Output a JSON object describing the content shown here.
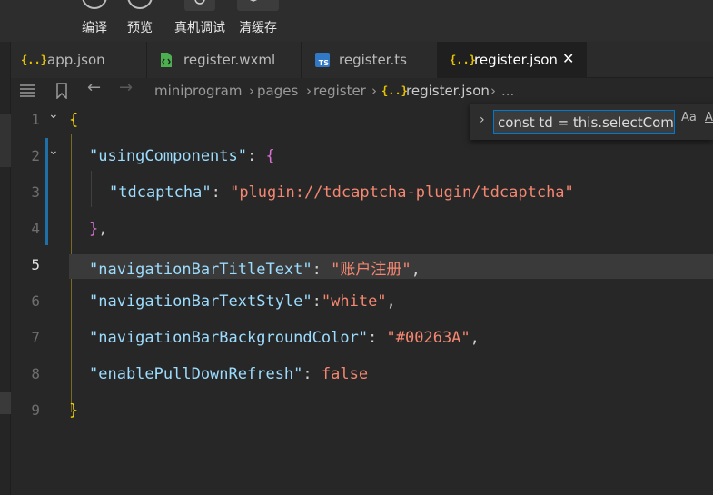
{
  "toolbar": {
    "compile_label": "编译",
    "preview_label": "预览",
    "debug_label": "真机调试",
    "clear_cache_label": "清缓存"
  },
  "tabs": [
    {
      "label": "app.json",
      "icon": "json-braces-icon"
    },
    {
      "label": "register.wxml",
      "icon": "wxml-file-icon"
    },
    {
      "label": "register.ts",
      "icon": "typescript-file-icon"
    },
    {
      "label": "register.json",
      "icon": "json-braces-icon",
      "active": true
    }
  ],
  "tab_json_icon_text": "{..}",
  "tab_ts_icon_text": "TS",
  "close_glyph": "✕",
  "breadcrumb": {
    "parts": [
      "miniprogram",
      "pages",
      "register"
    ],
    "file": "register.json",
    "ellipsis": "..."
  },
  "find_widget": {
    "query": "const td = this.selectComponent",
    "match_case_label": "Aa",
    "whole_word_label": "AB"
  },
  "editor": {
    "current_line": 5,
    "line_numbers": [
      "1",
      "2",
      "3",
      "4",
      "5",
      "6",
      "7",
      "8",
      "9"
    ],
    "lines": {
      "l1_brace": "{",
      "l2_key": "\"usingComponents\"",
      "l2_colon": ": ",
      "l2_brace": "{",
      "l3_key": "\"tdcaptcha\"",
      "l3_colon": ": ",
      "l3_value": "\"plugin://tdcaptcha-plugin/tdcaptcha\"",
      "l4_brace": "}",
      "l4_comma": ",",
      "l5_key": "\"navigationBarTitleText\"",
      "l5_colon": ": ",
      "l5_value": "\"账户注册\"",
      "l5_comma": ",",
      "l6_key": "\"navigationBarTextStyle\"",
      "l6_colon": ":",
      "l6_value": "\"white\"",
      "l6_comma": ",",
      "l7_key": "\"navigationBarBackgroundColor\"",
      "l7_colon": ": ",
      "l7_value": "\"#00263A\"",
      "l7_comma": ",",
      "l8_key": "\"enablePullDownRefresh\"",
      "l8_colon": ": ",
      "l8_value": "false",
      "l9_brace": "}"
    }
  },
  "colors": {
    "background": "#272727",
    "key": "#9cdcfe",
    "string": "#f48771",
    "bracket_level1": "#ffd700",
    "bracket_level2": "#da70d6",
    "json_icon": "#e6c300",
    "ts_icon": "#3178c6",
    "wxml_icon": "#4caf50"
  }
}
